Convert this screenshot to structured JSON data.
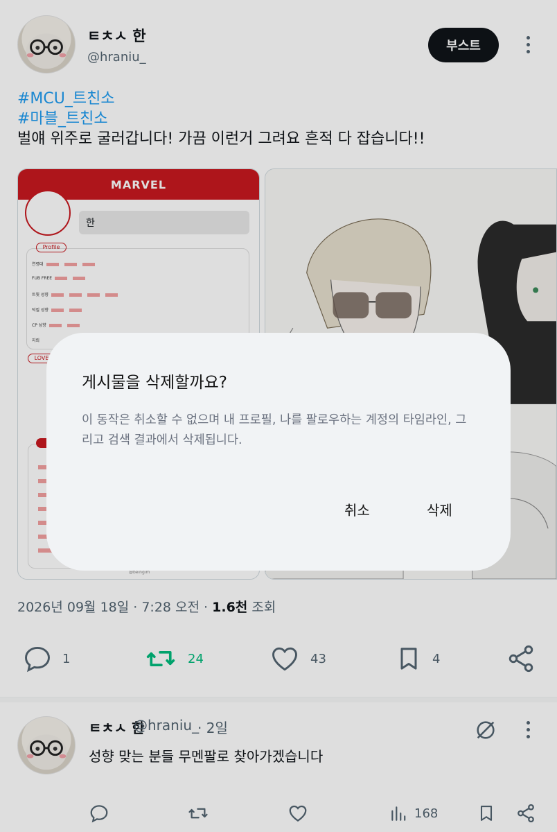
{
  "post": {
    "author_name": "ㅌㅊㅅ 한",
    "author_handle": "@hraniu_",
    "boost_label": "부스트",
    "hashtags": [
      "#MCU_트친소",
      "#마블_트친소"
    ],
    "text": "벌얘 위주로 굴러갑니다! 가끔 이런거 그려요 흔적 다 잡습니다!!",
    "media": {
      "sheet_header": "MARVEL",
      "sheet_name": "한",
      "sheet_profile_tag": "Profile",
      "sheet_love_tag": "LOVE",
      "sheet_rows": [
        "연령대",
        "FUB FREE",
        "트윗 성향",
        "덕질 성향",
        "CP 성향",
        "지뢰"
      ],
      "sheet_credit": "@beingim"
    },
    "timestamp": "2026년 09월 18일 · 7:28 오전 · ",
    "views_count": "1.6천",
    "views_label": " 조회",
    "stats": {
      "replies": "1",
      "reposts": "24",
      "likes": "43",
      "bookmarks": "4"
    }
  },
  "reply": {
    "author_name": "ㅌㅊㅅ 한",
    "author_handle": "@hraniu_",
    "time": "· 2일",
    "text": "성향 맞는 분들 무멘팔로 찾아가겠습니다",
    "views": "168"
  },
  "dialog": {
    "title": "게시물을 삭제할까요?",
    "body": "이 동작은 취소할 수 없으며 내 프로필, 나를 팔로우하는 계정의 타임라인, 그리고 검색 결과에서 삭제됩니다.",
    "cancel_label": "취소",
    "delete_label": "삭제"
  },
  "colors": {
    "accent": "#1d9bf0",
    "repost_active": "#00ba7c",
    "text_secondary": "#536471",
    "brand_red": "#c8191f"
  },
  "icons": [
    "reply-icon",
    "repost-icon",
    "like-icon",
    "bookmark-icon",
    "share-icon",
    "views-icon",
    "grok-icon",
    "more-icon"
  ]
}
